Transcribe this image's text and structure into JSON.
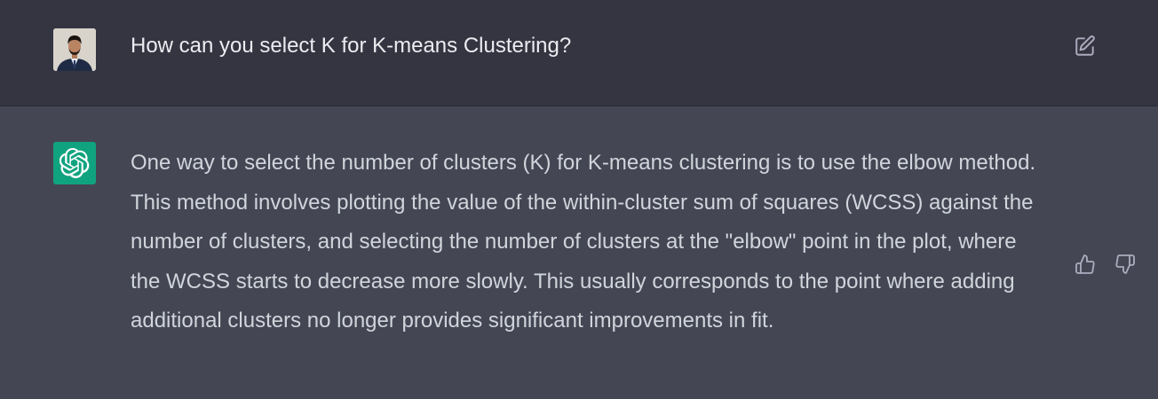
{
  "user_message": {
    "avatar_icon": "user-avatar",
    "text": "How can you select K for K-means Clustering?",
    "edit_icon": "edit-icon"
  },
  "assistant_message": {
    "avatar_icon": "openai-logo-icon",
    "text": "One way to select the number of clusters (K) for K-means clustering is to use the elbow method. This method involves plotting the value of the within-cluster sum of squares (WCSS) against the number of clusters, and selecting the number of clusters at the \"elbow\" point in the plot, where the WCSS starts to decrease more slowly. This usually corresponds to the point where adding additional clusters no longer provides significant improvements in fit.",
    "thumbs_up_icon": "thumbs-up-icon",
    "thumbs_down_icon": "thumbs-down-icon"
  },
  "colors": {
    "user_bg": "#343541",
    "assistant_bg": "#444654",
    "assistant_avatar_bg": "#10a37f",
    "text": "#ececf1",
    "icon": "#acacbe"
  }
}
